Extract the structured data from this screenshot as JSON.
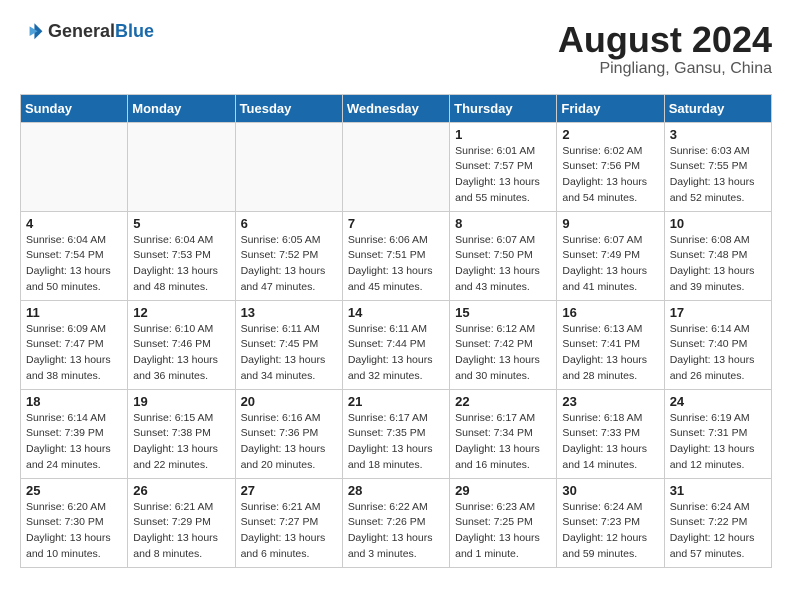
{
  "logo": {
    "general": "General",
    "blue": "Blue"
  },
  "title": {
    "month_year": "August 2024",
    "location": "Pingliang, Gansu, China"
  },
  "weekdays": [
    "Sunday",
    "Monday",
    "Tuesday",
    "Wednesday",
    "Thursday",
    "Friday",
    "Saturday"
  ],
  "weeks": [
    [
      {
        "day": "",
        "sunrise": "",
        "sunset": "",
        "daylight": ""
      },
      {
        "day": "",
        "sunrise": "",
        "sunset": "",
        "daylight": ""
      },
      {
        "day": "",
        "sunrise": "",
        "sunset": "",
        "daylight": ""
      },
      {
        "day": "",
        "sunrise": "",
        "sunset": "",
        "daylight": ""
      },
      {
        "day": "1",
        "sunrise": "Sunrise: 6:01 AM",
        "sunset": "Sunset: 7:57 PM",
        "daylight": "Daylight: 13 hours and 55 minutes."
      },
      {
        "day": "2",
        "sunrise": "Sunrise: 6:02 AM",
        "sunset": "Sunset: 7:56 PM",
        "daylight": "Daylight: 13 hours and 54 minutes."
      },
      {
        "day": "3",
        "sunrise": "Sunrise: 6:03 AM",
        "sunset": "Sunset: 7:55 PM",
        "daylight": "Daylight: 13 hours and 52 minutes."
      }
    ],
    [
      {
        "day": "4",
        "sunrise": "Sunrise: 6:04 AM",
        "sunset": "Sunset: 7:54 PM",
        "daylight": "Daylight: 13 hours and 50 minutes."
      },
      {
        "day": "5",
        "sunrise": "Sunrise: 6:04 AM",
        "sunset": "Sunset: 7:53 PM",
        "daylight": "Daylight: 13 hours and 48 minutes."
      },
      {
        "day": "6",
        "sunrise": "Sunrise: 6:05 AM",
        "sunset": "Sunset: 7:52 PM",
        "daylight": "Daylight: 13 hours and 47 minutes."
      },
      {
        "day": "7",
        "sunrise": "Sunrise: 6:06 AM",
        "sunset": "Sunset: 7:51 PM",
        "daylight": "Daylight: 13 hours and 45 minutes."
      },
      {
        "day": "8",
        "sunrise": "Sunrise: 6:07 AM",
        "sunset": "Sunset: 7:50 PM",
        "daylight": "Daylight: 13 hours and 43 minutes."
      },
      {
        "day": "9",
        "sunrise": "Sunrise: 6:07 AM",
        "sunset": "Sunset: 7:49 PM",
        "daylight": "Daylight: 13 hours and 41 minutes."
      },
      {
        "day": "10",
        "sunrise": "Sunrise: 6:08 AM",
        "sunset": "Sunset: 7:48 PM",
        "daylight": "Daylight: 13 hours and 39 minutes."
      }
    ],
    [
      {
        "day": "11",
        "sunrise": "Sunrise: 6:09 AM",
        "sunset": "Sunset: 7:47 PM",
        "daylight": "Daylight: 13 hours and 38 minutes."
      },
      {
        "day": "12",
        "sunrise": "Sunrise: 6:10 AM",
        "sunset": "Sunset: 7:46 PM",
        "daylight": "Daylight: 13 hours and 36 minutes."
      },
      {
        "day": "13",
        "sunrise": "Sunrise: 6:11 AM",
        "sunset": "Sunset: 7:45 PM",
        "daylight": "Daylight: 13 hours and 34 minutes."
      },
      {
        "day": "14",
        "sunrise": "Sunrise: 6:11 AM",
        "sunset": "Sunset: 7:44 PM",
        "daylight": "Daylight: 13 hours and 32 minutes."
      },
      {
        "day": "15",
        "sunrise": "Sunrise: 6:12 AM",
        "sunset": "Sunset: 7:42 PM",
        "daylight": "Daylight: 13 hours and 30 minutes."
      },
      {
        "day": "16",
        "sunrise": "Sunrise: 6:13 AM",
        "sunset": "Sunset: 7:41 PM",
        "daylight": "Daylight: 13 hours and 28 minutes."
      },
      {
        "day": "17",
        "sunrise": "Sunrise: 6:14 AM",
        "sunset": "Sunset: 7:40 PM",
        "daylight": "Daylight: 13 hours and 26 minutes."
      }
    ],
    [
      {
        "day": "18",
        "sunrise": "Sunrise: 6:14 AM",
        "sunset": "Sunset: 7:39 PM",
        "daylight": "Daylight: 13 hours and 24 minutes."
      },
      {
        "day": "19",
        "sunrise": "Sunrise: 6:15 AM",
        "sunset": "Sunset: 7:38 PM",
        "daylight": "Daylight: 13 hours and 22 minutes."
      },
      {
        "day": "20",
        "sunrise": "Sunrise: 6:16 AM",
        "sunset": "Sunset: 7:36 PM",
        "daylight": "Daylight: 13 hours and 20 minutes."
      },
      {
        "day": "21",
        "sunrise": "Sunrise: 6:17 AM",
        "sunset": "Sunset: 7:35 PM",
        "daylight": "Daylight: 13 hours and 18 minutes."
      },
      {
        "day": "22",
        "sunrise": "Sunrise: 6:17 AM",
        "sunset": "Sunset: 7:34 PM",
        "daylight": "Daylight: 13 hours and 16 minutes."
      },
      {
        "day": "23",
        "sunrise": "Sunrise: 6:18 AM",
        "sunset": "Sunset: 7:33 PM",
        "daylight": "Daylight: 13 hours and 14 minutes."
      },
      {
        "day": "24",
        "sunrise": "Sunrise: 6:19 AM",
        "sunset": "Sunset: 7:31 PM",
        "daylight": "Daylight: 13 hours and 12 minutes."
      }
    ],
    [
      {
        "day": "25",
        "sunrise": "Sunrise: 6:20 AM",
        "sunset": "Sunset: 7:30 PM",
        "daylight": "Daylight: 13 hours and 10 minutes."
      },
      {
        "day": "26",
        "sunrise": "Sunrise: 6:21 AM",
        "sunset": "Sunset: 7:29 PM",
        "daylight": "Daylight: 13 hours and 8 minutes."
      },
      {
        "day": "27",
        "sunrise": "Sunrise: 6:21 AM",
        "sunset": "Sunset: 7:27 PM",
        "daylight": "Daylight: 13 hours and 6 minutes."
      },
      {
        "day": "28",
        "sunrise": "Sunrise: 6:22 AM",
        "sunset": "Sunset: 7:26 PM",
        "daylight": "Daylight: 13 hours and 3 minutes."
      },
      {
        "day": "29",
        "sunrise": "Sunrise: 6:23 AM",
        "sunset": "Sunset: 7:25 PM",
        "daylight": "Daylight: 13 hours and 1 minute."
      },
      {
        "day": "30",
        "sunrise": "Sunrise: 6:24 AM",
        "sunset": "Sunset: 7:23 PM",
        "daylight": "Daylight: 12 hours and 59 minutes."
      },
      {
        "day": "31",
        "sunrise": "Sunrise: 6:24 AM",
        "sunset": "Sunset: 7:22 PM",
        "daylight": "Daylight: 12 hours and 57 minutes."
      }
    ]
  ]
}
